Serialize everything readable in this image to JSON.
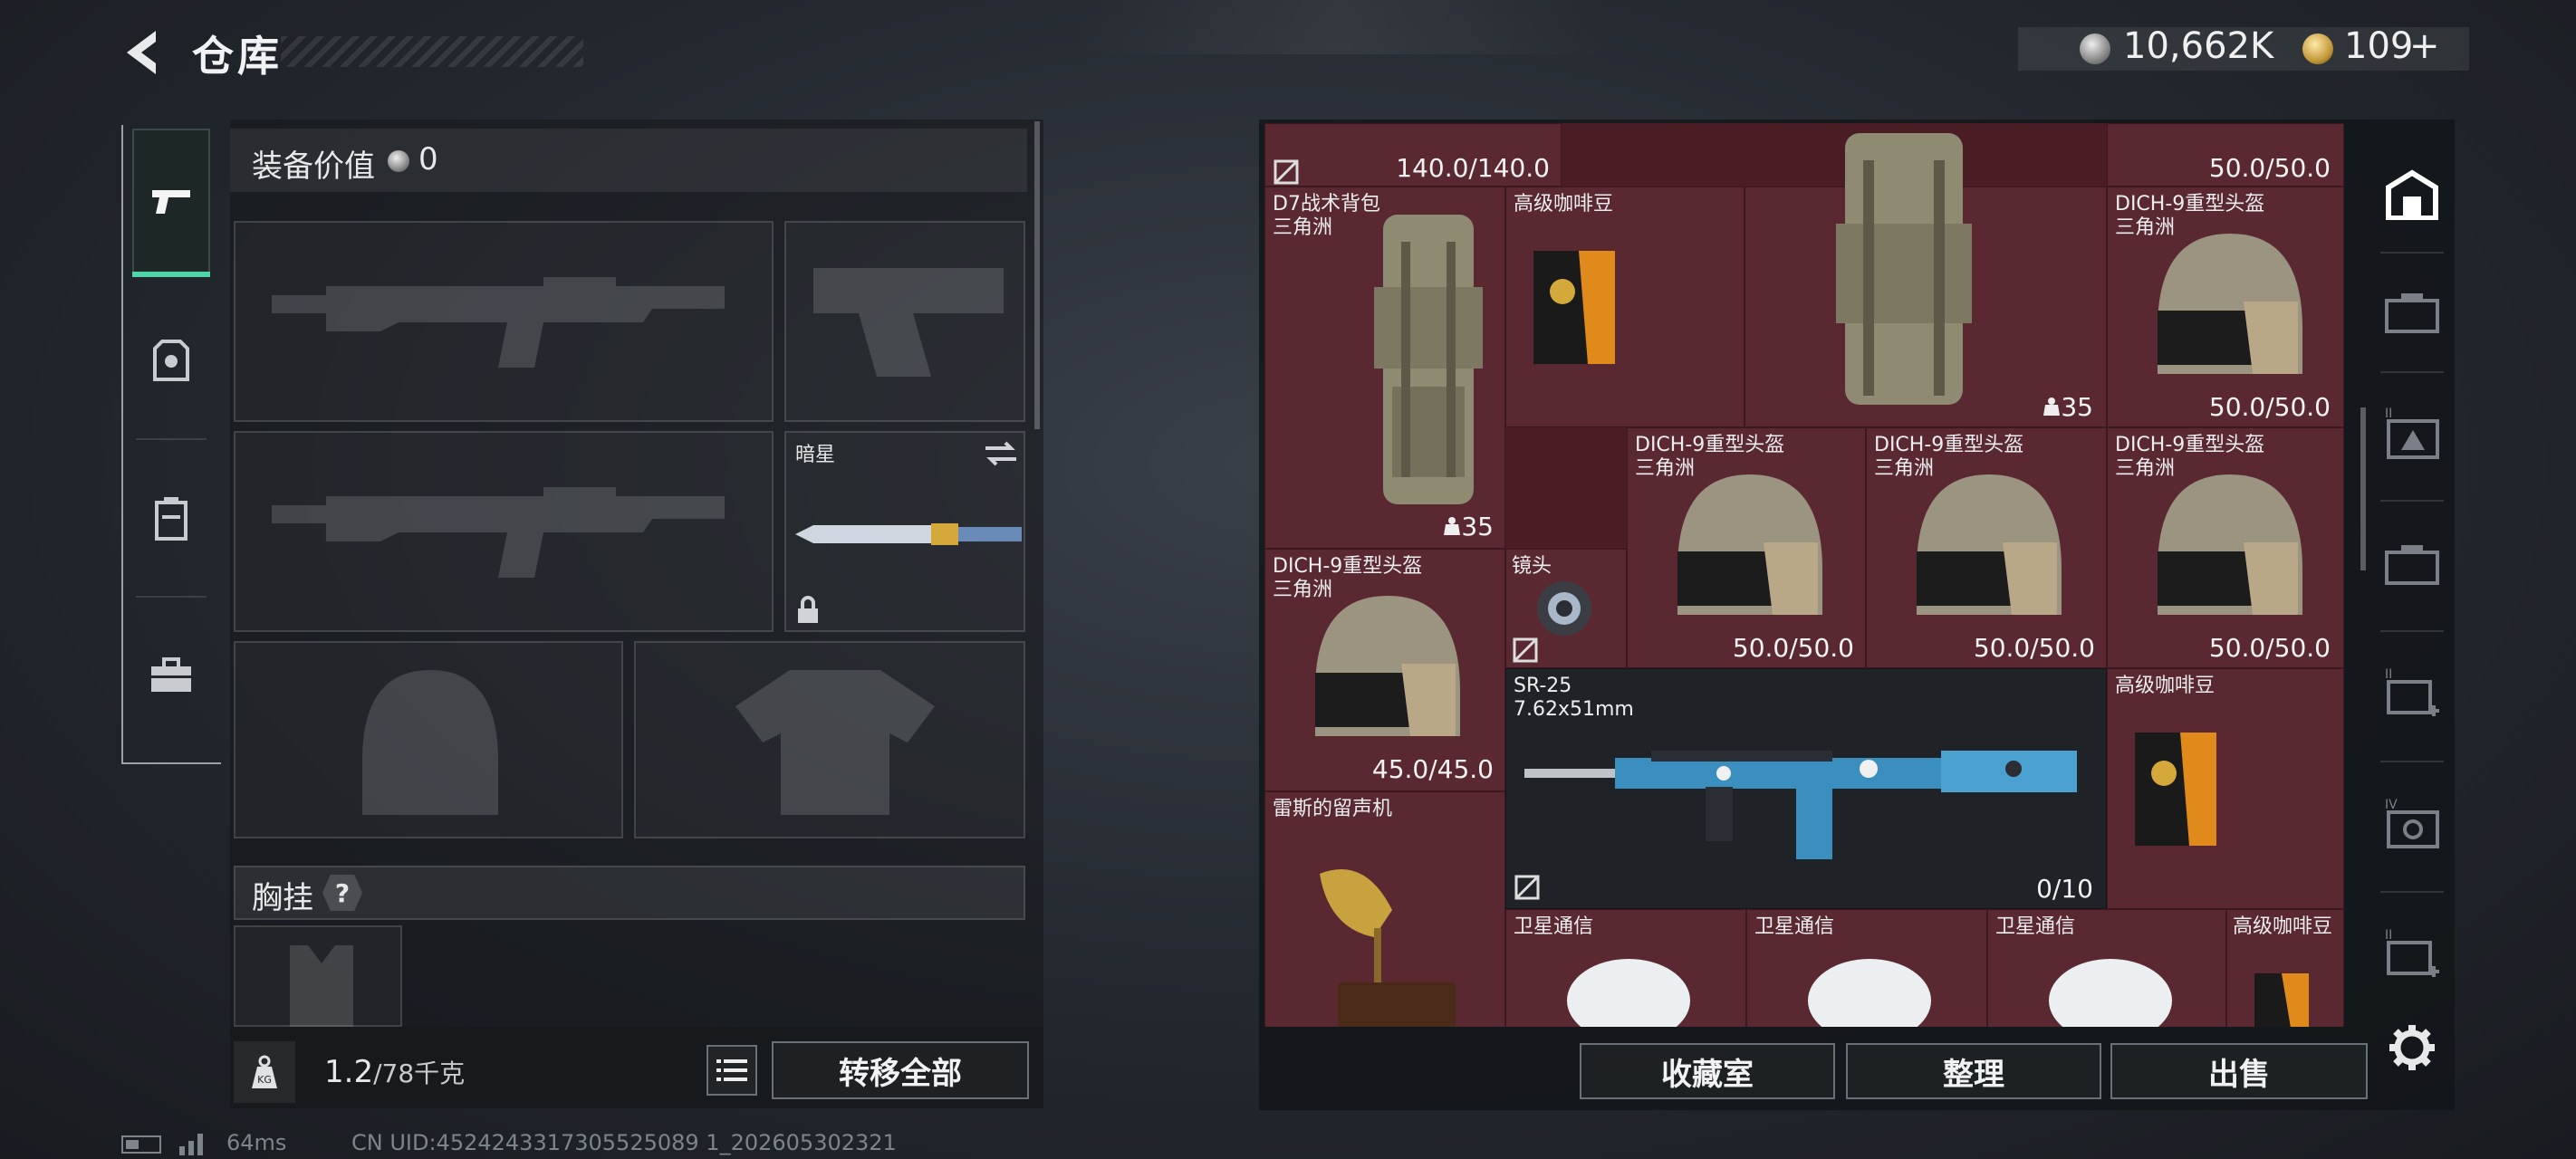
{
  "header": {
    "title": "仓库",
    "silver_value": "10,662K",
    "gold_value": "109",
    "gold_plus": "+"
  },
  "equipment": {
    "value_label": "装备价值",
    "value": "0",
    "knife_name": "暗星",
    "chest_rig_label": "胸挂",
    "help_mark": "?",
    "weight_value": "1.2",
    "weight_unit": "/78千克",
    "kg_label": "KG",
    "transfer_all": "转移全部"
  },
  "stash": {
    "items": [
      {
        "name": "",
        "sub": "",
        "value": "140.0/140.0"
      },
      {
        "name": "",
        "sub": "",
        "value": "50.0/50.0"
      },
      {
        "name": "D7战术背包",
        "sub": "三角洲",
        "value": "35"
      },
      {
        "name": "高级咖啡豆",
        "sub": "",
        "value": ""
      },
      {
        "name": "",
        "sub": "",
        "value": "35"
      },
      {
        "name": "DICH-9重型头盔",
        "sub": "三角洲",
        "value": "50.0/50.0"
      },
      {
        "name": "DICH-9重型头盔",
        "sub": "三角洲",
        "value": "50.0/50.0"
      },
      {
        "name": "DICH-9重型头盔",
        "sub": "三角洲",
        "value": "50.0/50.0"
      },
      {
        "name": "DICH-9重型头盔",
        "sub": "三角洲",
        "value": "50.0/50.0"
      },
      {
        "name": "DICH-9重型头盔",
        "sub": "三角洲",
        "value": "45.0/45.0"
      },
      {
        "name": "镜头",
        "sub": "",
        "value": ""
      },
      {
        "name": "SR-25",
        "sub": "7.62x51mm",
        "value": "0/10"
      },
      {
        "name": "高级咖啡豆",
        "sub": "",
        "value": ""
      },
      {
        "name": "雷斯的留声机",
        "sub": "",
        "value": ""
      },
      {
        "name": "卫星通信",
        "sub": "",
        "value": ""
      },
      {
        "name": "卫星通信",
        "sub": "",
        "value": ""
      },
      {
        "name": "卫星通信",
        "sub": "",
        "value": ""
      },
      {
        "name": "高级咖啡豆",
        "sub": "",
        "value": ""
      }
    ],
    "buttons": {
      "collection": "收藏室",
      "sort": "整理",
      "sell": "出售"
    }
  },
  "categories": [
    {
      "icon": "stash-home-icon"
    },
    {
      "icon": "case-1-icon",
      "level": ""
    },
    {
      "icon": "case-2-icon",
      "level": "II"
    },
    {
      "icon": "case-3-icon",
      "level": ""
    },
    {
      "icon": "case-add-icon",
      "level": "II"
    },
    {
      "icon": "case-4-icon",
      "level": "IV"
    },
    {
      "icon": "case-add-2-icon",
      "level": "II"
    }
  ],
  "status": {
    "ping": "64ms",
    "uid": "CN UID:4524243317305525089 1_202605302321"
  },
  "colors": {
    "accent": "#4fd3a9",
    "stash_cell": "#5a2830",
    "weapon_cell": "#1f2328"
  }
}
